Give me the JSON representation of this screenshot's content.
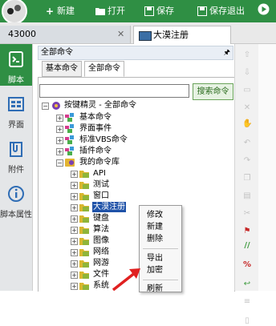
{
  "toolbar": {
    "new_label": "新建",
    "open_label": "打开",
    "save_label": "保存",
    "save_exit_label": "保存退出"
  },
  "tabs": {
    "file_tab": "43000",
    "editor_tab": "大漠注册"
  },
  "sidebar": {
    "items": [
      {
        "label": "脚本",
        "icon": "script-icon"
      },
      {
        "label": "界面",
        "icon": "interface-icon"
      },
      {
        "label": "附件",
        "icon": "attachment-icon"
      },
      {
        "label": "脚本属性",
        "icon": "info-icon"
      }
    ]
  },
  "panel": {
    "title": "全部命令",
    "subtabs": [
      "基本命令",
      "全部命令"
    ],
    "search_value": "",
    "search_button": "搜索命令"
  },
  "tree": {
    "root": "按键精灵 - 全部命令",
    "groups": [
      "基本命令",
      "界面事件",
      "标准VBS命令",
      "插件命令",
      "我的命令库"
    ],
    "library_items": [
      "API",
      "测试",
      "窗口",
      "大漠注册",
      "键盘",
      "算法",
      "图像",
      "网络",
      "网游",
      "文件",
      "系统"
    ],
    "selected": "大漠注册"
  },
  "context_menu": {
    "items": [
      "修改",
      "新建",
      "删除",
      "导出",
      "加密",
      "刷新"
    ]
  },
  "colors": {
    "accent_green": "#2f8f44",
    "selection_blue": "#1f52a8",
    "arrow_red": "#e02020"
  }
}
